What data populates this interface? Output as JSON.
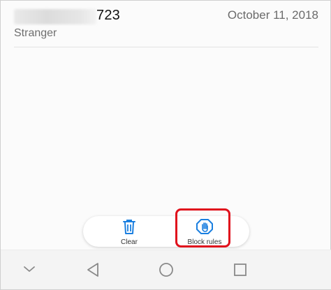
{
  "call_entry": {
    "number_visible_tail": "723",
    "date": "October 11, 2018",
    "label": "Stranger"
  },
  "actions": {
    "clear_label": "Clear",
    "block_rules_label": "Block rules"
  },
  "colors": {
    "accent": "#1a7fe0",
    "highlight": "#e0101c"
  },
  "icons": {
    "clear": "trash-icon",
    "block_rules": "hand-stop-icon",
    "nav_collapse": "chevron-down-icon",
    "nav_back": "back-triangle-icon",
    "nav_home": "home-circle-icon",
    "nav_recents": "recents-square-icon"
  }
}
